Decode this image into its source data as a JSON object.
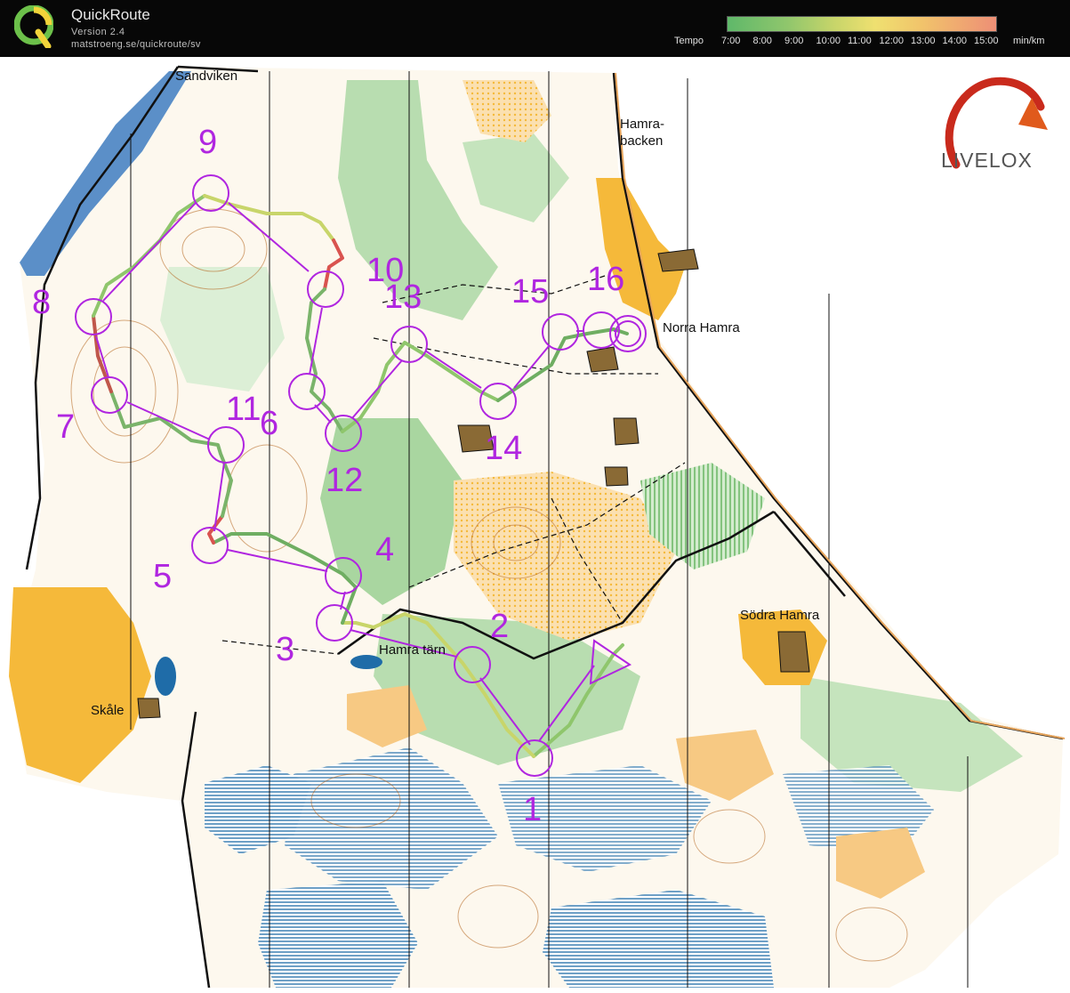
{
  "header": {
    "app_name": "QuickRoute",
    "version": "Version 2.4",
    "url": "matstroeng.se/quickroute/sv",
    "tempo_label": "Tempo",
    "tempo_ticks": [
      "7:00",
      "8:00",
      "9:00",
      "10:00",
      "11:00",
      "12:00",
      "13:00",
      "14:00",
      "15:00"
    ],
    "tempo_unit": "min/km"
  },
  "map": {
    "watermark": "LIVELOX",
    "places": [
      "Sandviken",
      "Hamra-",
      "backen",
      "Norra Hamra",
      "Södra Hamra",
      "Hamra tärn",
      "Skåle"
    ],
    "controls": [
      "1",
      "2",
      "3",
      "4",
      "5",
      "6",
      "7",
      "8",
      "9",
      "10",
      "11",
      "12",
      "13",
      "14",
      "15",
      "16"
    ],
    "colors": {
      "course": "#b026e0",
      "route_fast": "#5fa85a",
      "route_slow": "#d9534f",
      "open_land": "#f5b93a",
      "forest_green": "#a9d6a0",
      "marsh": "#1f6ca8",
      "water": "#4a78b5",
      "contour": "#b5651d"
    }
  }
}
